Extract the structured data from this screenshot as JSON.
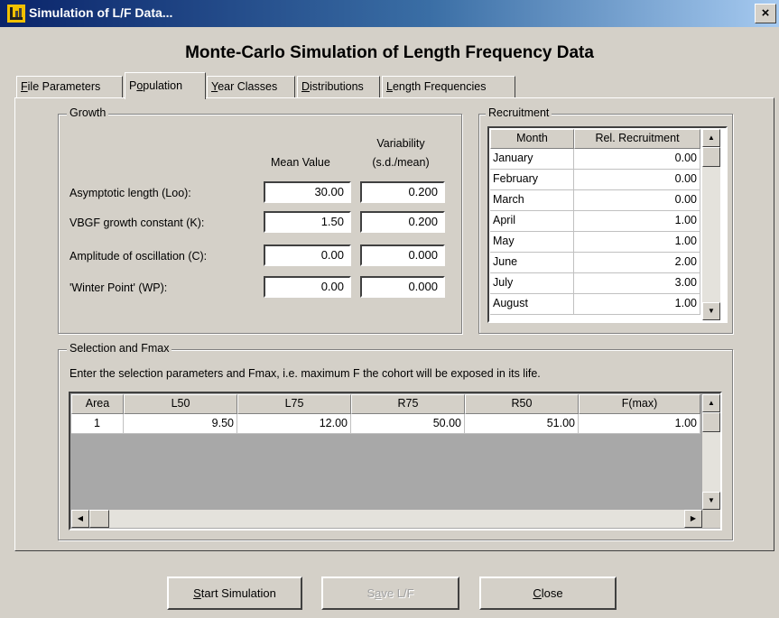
{
  "window": {
    "title": "Simulation of L/F Data...",
    "close_glyph": "×"
  },
  "heading": "Monte-Carlo Simulation of Length Frequency Data",
  "tabs": [
    {
      "mn": "F",
      "rest": "ile Parameters"
    },
    {
      "pre": "P",
      "mn": "o",
      "rest": "pulation"
    },
    {
      "mn": "Y",
      "rest": "ear Classes"
    },
    {
      "mn": "D",
      "rest": "istributions"
    },
    {
      "mn": "L",
      "rest": "ength Frequencies"
    }
  ],
  "growth": {
    "title": "Growth",
    "col_mean": "Mean Value",
    "col_var_1": "Variability",
    "col_var_2": "(s.d./mean)",
    "rows": [
      {
        "label": "Asymptotic length (Loo):",
        "mean": "30.00",
        "var": "0.200"
      },
      {
        "label": "VBGF growth constant (K):",
        "mean": "1.50",
        "var": "0.200"
      },
      {
        "label": "Amplitude of oscillation (C):",
        "mean": "0.00",
        "var": "0.000"
      },
      {
        "label": "'Winter Point' (WP):",
        "mean": "0.00",
        "var": "0.000"
      }
    ]
  },
  "recruitment": {
    "title": "Recruitment",
    "headers": [
      "Month",
      "Rel. Recruitment"
    ],
    "rows": [
      {
        "month": "January",
        "value": "0.00"
      },
      {
        "month": "February",
        "value": "0.00"
      },
      {
        "month": "March",
        "value": "0.00"
      },
      {
        "month": "April",
        "value": "1.00"
      },
      {
        "month": "May",
        "value": "1.00"
      },
      {
        "month": "June",
        "value": "2.00"
      },
      {
        "month": "July",
        "value": "3.00"
      },
      {
        "month": "August",
        "value": "1.00"
      }
    ]
  },
  "selection": {
    "title": "Selection and Fmax",
    "description": "Enter the selection parameters and Fmax, i.e. maximum F the cohort will be exposed in its life.",
    "headers": [
      "Area",
      "L50",
      "L75",
      "R75",
      "R50",
      "F(max)"
    ],
    "rows": [
      {
        "area": "1",
        "l50": "9.50",
        "l75": "12.00",
        "r75": "50.00",
        "r50": "51.00",
        "fmax": "1.00"
      }
    ]
  },
  "buttons": {
    "start": {
      "mn": "S",
      "rest": "tart Simulation"
    },
    "save": {
      "pre": "S",
      "mn": "a",
      "rest": "ve L/F"
    },
    "close": {
      "mn": "C",
      "rest": "lose"
    }
  },
  "icons": {
    "app": "fish-scale-icon",
    "scroll_up": "▲",
    "scroll_down": "▼",
    "scroll_left": "◀",
    "scroll_right": "▶"
  }
}
